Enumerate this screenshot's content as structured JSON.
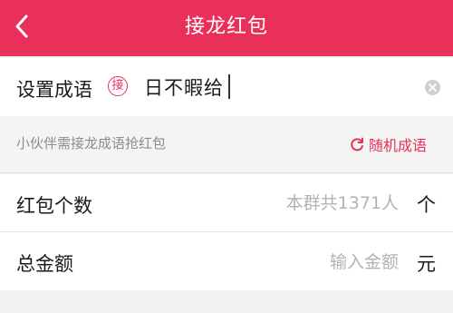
{
  "header": {
    "title": "接龙红包",
    "back_icon": "chevron-left-icon",
    "background_color": "#e8305a"
  },
  "idiom": {
    "label": "设置成语",
    "badge": "接",
    "value": "日不暇给",
    "clear_icon": "clear-circle-icon"
  },
  "hint": {
    "text": "小伙伴需接龙成语抢红包",
    "random_label": "随机成语",
    "random_icon": "refresh-icon"
  },
  "count": {
    "label": "红包个数",
    "placeholder": "本群共1371人",
    "unit": "个"
  },
  "amount": {
    "label": "总金额",
    "placeholder": "输入金额",
    "unit": "元"
  },
  "accent_color": "#e8305a"
}
